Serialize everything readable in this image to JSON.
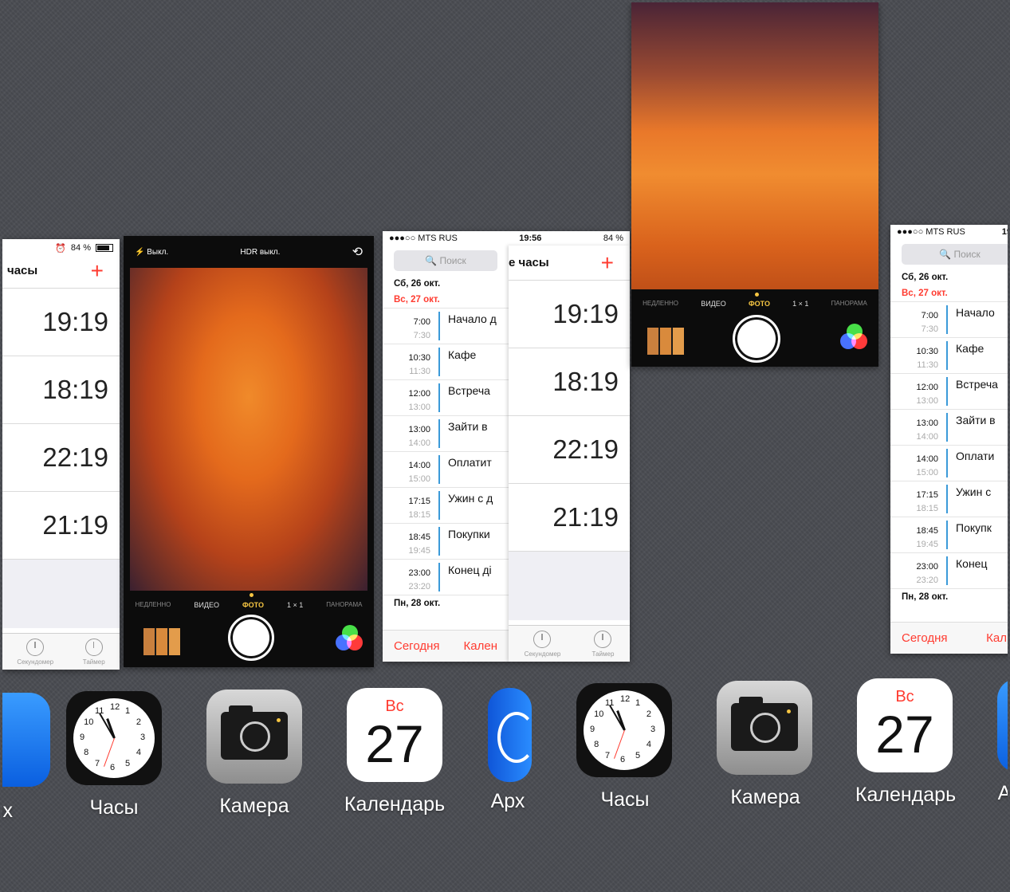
{
  "clock_cards": [
    {
      "status_battery": "84 %",
      "title": "часы",
      "times": [
        "19:19",
        "18:19",
        "22:19",
        "21:19"
      ],
      "tabs": [
        "Секундомер",
        "Таймер"
      ]
    },
    {
      "status_battery": "84 %",
      "title": "е часы",
      "times": [
        "19:19",
        "18:19",
        "22:19",
        "21:19"
      ],
      "tabs": [
        "Секундомер",
        "Таймер"
      ]
    }
  ],
  "camera_card": {
    "flash": "Выкл.",
    "hdr": "HDR выкл.",
    "modes": [
      "НЕДЛЕННО",
      "ВИДЕО",
      "ФОТО",
      "1 × 1",
      "ПАНОРАМА"
    ],
    "active_mode": "ФОТО"
  },
  "camera_card_2": {
    "modes": [
      "НЕДЛЕННО",
      "ВИДЕО",
      "ФОТО",
      "1 × 1",
      "ПАНОРАМА"
    ]
  },
  "calendar_cards": [
    {
      "carrier": "●●●○○ MTS RUS",
      "time": "19:56",
      "battery": "84 %",
      "search_placeholder": "Поиск",
      "day1": "Сб, 26 окт.",
      "day2": "Вс, 27 окт.",
      "events": [
        {
          "start": "7:00",
          "end": "7:30",
          "name": "Начало д"
        },
        {
          "start": "10:30",
          "end": "11:30",
          "name": "Кафе"
        },
        {
          "start": "12:00",
          "end": "13:00",
          "name": "Встреча"
        },
        {
          "start": "13:00",
          "end": "14:00",
          "name": "Зайти в"
        },
        {
          "start": "14:00",
          "end": "15:00",
          "name": "Оплатит"
        },
        {
          "start": "17:15",
          "end": "18:15",
          "name": "Ужин с д"
        },
        {
          "start": "18:45",
          "end": "19:45",
          "name": "Покупки"
        },
        {
          "start": "23:00",
          "end": "23:20",
          "name": "Конец ді"
        }
      ],
      "day3": "Пн, 28 окт.",
      "today": "Сегодня",
      "calendars": "Кален"
    },
    {
      "carrier": "●●●○○ MTS RUS",
      "time": "19",
      "battery": "",
      "search_placeholder": "Поиск",
      "day1": "Сб, 26 окт.",
      "day2": "Вс, 27 окт.",
      "events": [
        {
          "start": "7:00",
          "end": "7:30",
          "name": "Начало"
        },
        {
          "start": "10:30",
          "end": "11:30",
          "name": "Кафе"
        },
        {
          "start": "12:00",
          "end": "13:00",
          "name": "Встреча"
        },
        {
          "start": "13:00",
          "end": "14:00",
          "name": "Зайти в"
        },
        {
          "start": "14:00",
          "end": "15:00",
          "name": "Оплати"
        },
        {
          "start": "17:15",
          "end": "18:15",
          "name": "Ужин с"
        },
        {
          "start": "18:45",
          "end": "19:45",
          "name": "Покупк"
        },
        {
          "start": "23:00",
          "end": "23:20",
          "name": "Конец"
        }
      ],
      "day3": "Пн, 28 окт.",
      "today": "Сегодня",
      "calendars": "Кал"
    }
  ],
  "dock": {
    "partial_left_label": "рх",
    "clock_label": "Часы",
    "camera_label": "Камера",
    "calendar_label": "Календарь",
    "calendar_day": "Вс",
    "calendar_date": "27",
    "archive_label": "Арх",
    "partial_right_label": "А",
    "clock_numbers": [
      "12",
      "1",
      "2",
      "3",
      "4",
      "5",
      "6",
      "7",
      "8",
      "9",
      "10",
      "11"
    ]
  },
  "colors": {
    "accent_red": "#ff3b30",
    "active_mode": "#f5c542",
    "event_bar": "#3b9ad9",
    "blue_app": "#1a7cf0"
  }
}
